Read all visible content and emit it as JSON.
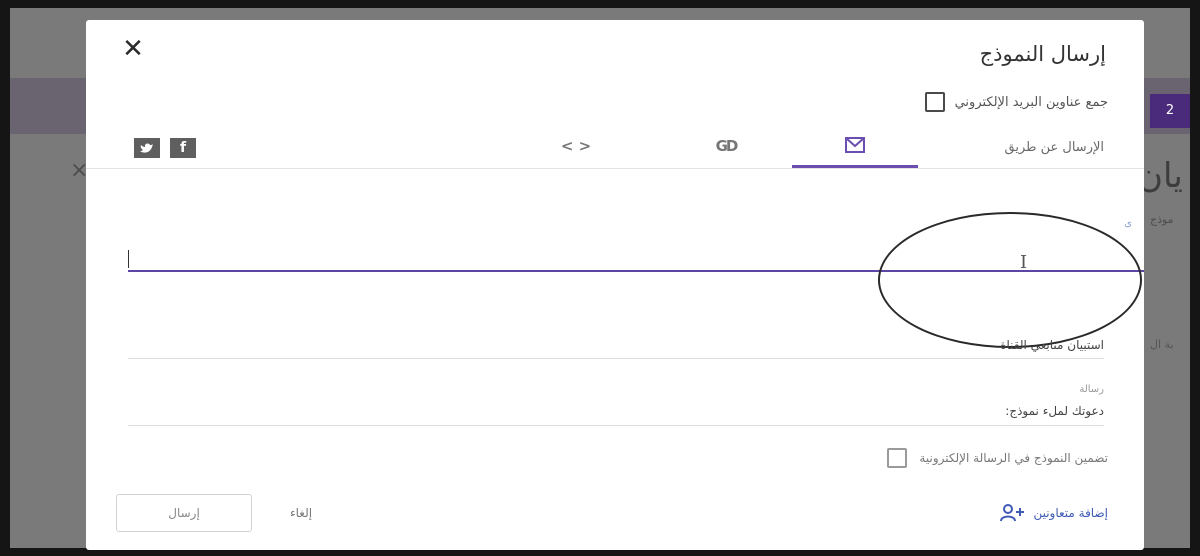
{
  "background": {
    "accent_text": "2",
    "close_glyph": "×",
    "title_fragment": "يان",
    "subtitle_fragment": "موذج",
    "side_fragment": "بة ال"
  },
  "dialog": {
    "title": "إرسال النموذج",
    "close_glyph": "✕",
    "collect_emails_label": "جمع عناوين البريد الإلكتروني",
    "send_via_label": "الإرسال عن طريق",
    "tabs": [
      {
        "name": "email",
        "icon": "envelope-icon",
        "active": true
      },
      {
        "name": "link",
        "icon": "link-icon",
        "glyph": "GD",
        "active": false
      },
      {
        "name": "embed",
        "icon": "embed-icon",
        "glyph": "< >",
        "active": false
      }
    ],
    "social": {
      "facebook_glyph": "f",
      "twitter_glyph": "t"
    },
    "to_label": "ى",
    "to_input_value": "",
    "cursor_glyph": "I",
    "subject_value": "استبيان متابعي القناة",
    "message_label": "رسالة",
    "message_value": "دعوتك لملء نموذج:",
    "include_form_label": "تضمين النموذج في الرسالة الإلكترونية",
    "add_collaborators_label": "إضافة متعاونين",
    "cancel_label": "إلغاء",
    "send_label": "إرسال"
  },
  "colors": {
    "accent_purple": "#6b4fb0",
    "link_blue": "#3f5bb5"
  }
}
